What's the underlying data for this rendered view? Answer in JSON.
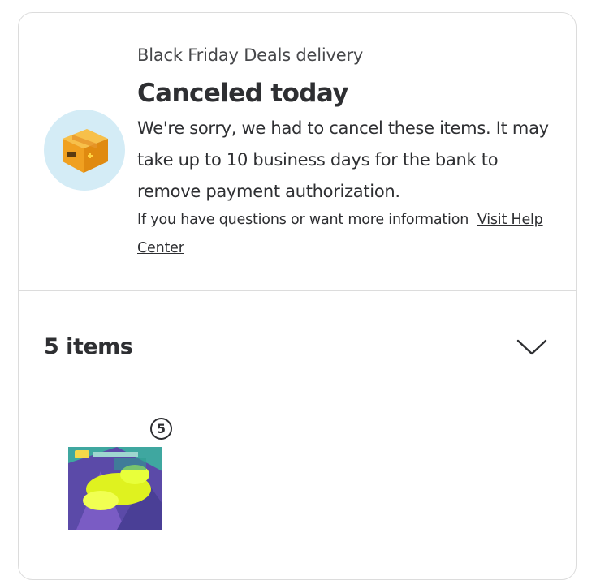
{
  "delivery": {
    "subtitle": "Black Friday Deals delivery",
    "status_title": "Canceled today",
    "message": "We're sorry, we had to cancel these items. It may take up to 10 business days for the bank to remove payment authorization.",
    "help_text": "If you have questions or want more information",
    "help_link": "Visit Help Center",
    "status_icon": "package-box-icon"
  },
  "items": {
    "count_label": "5 items",
    "expand_icon": "chevron-down-icon",
    "products": [
      {
        "quantity": "5",
        "image": "trading-card-product-image"
      }
    ]
  },
  "colors": {
    "text": "#2e2f32",
    "border": "#dcdcdc",
    "icon_bg": "#d4ecf6",
    "box_orange": "#f5a623"
  }
}
